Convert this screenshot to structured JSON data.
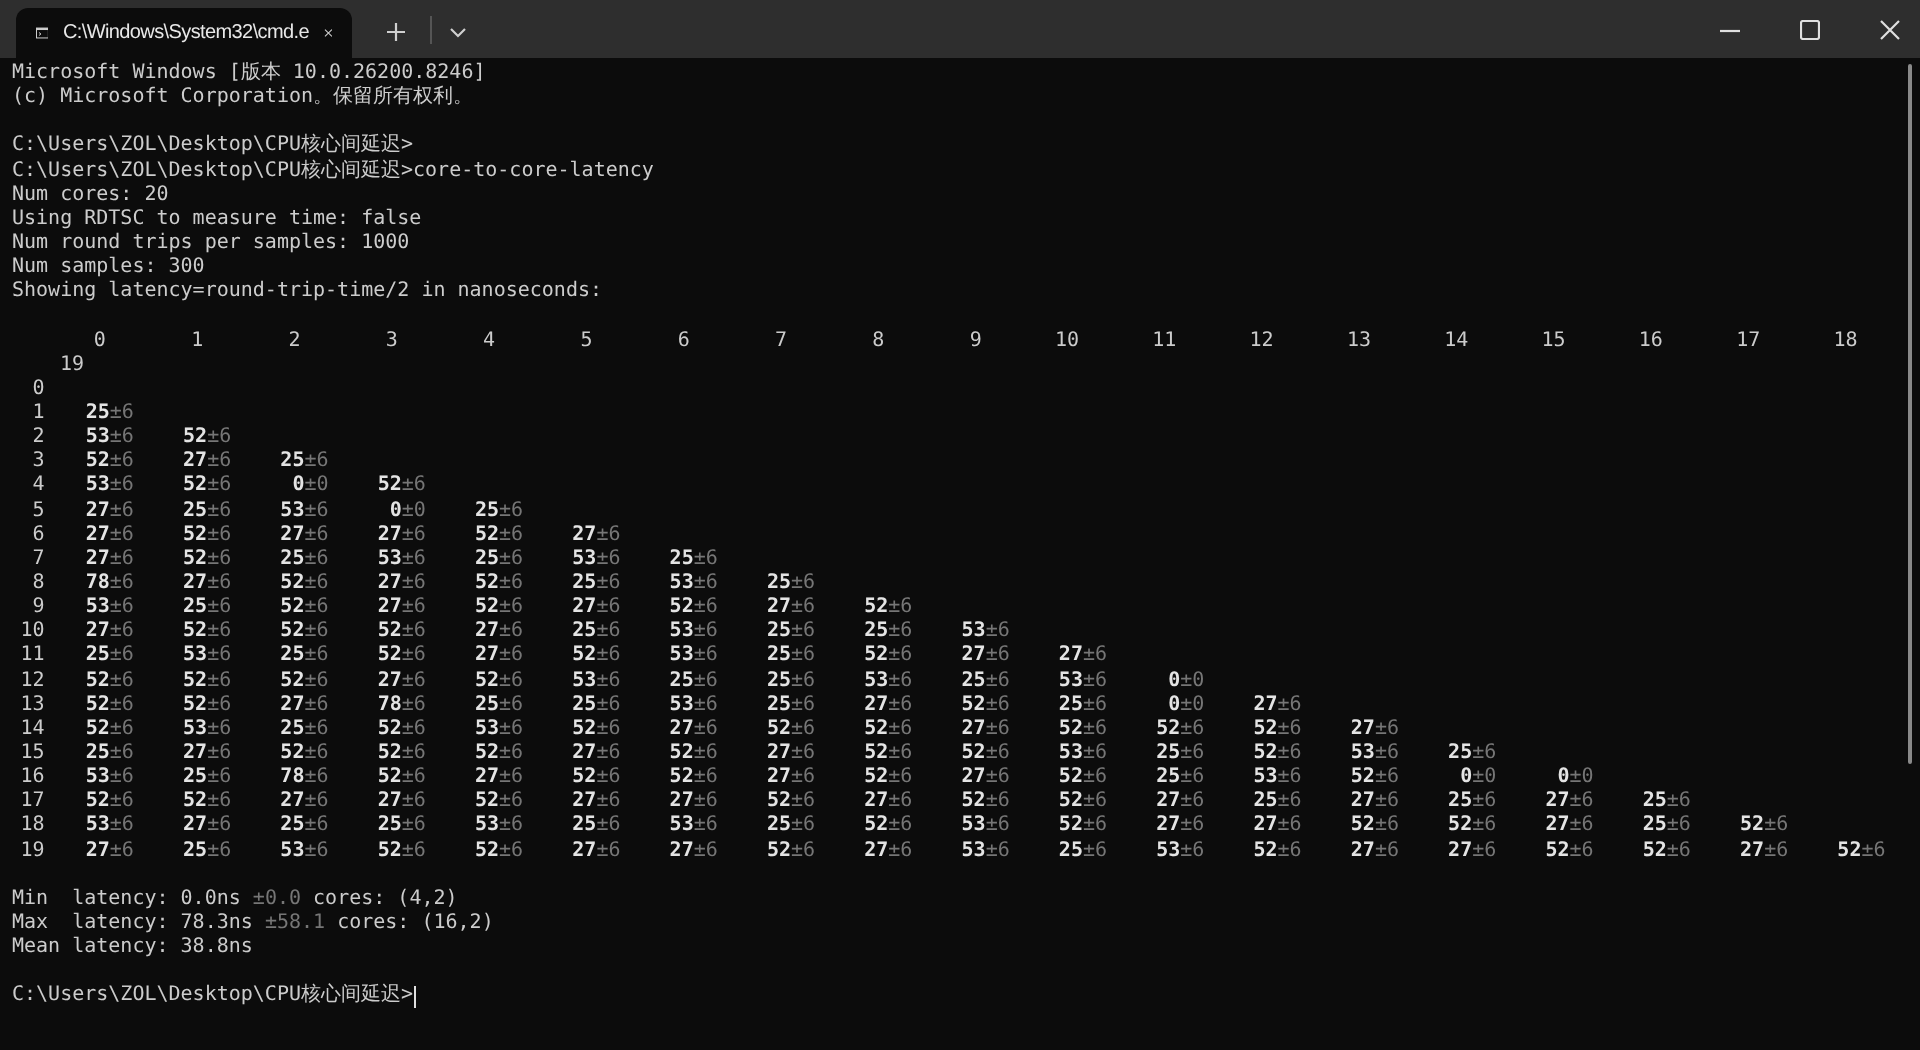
{
  "window": {
    "tab_title": "C:\\Windows\\System32\\cmd.e"
  },
  "output_blocks": [
    [
      "Microsoft Windows [版本 10.0.26200.8246]",
      "(c) Microsoft Corporation。保留所有权利。"
    ],
    [
      "C:\\Users\\ZOL\\Desktop\\CPU核心间延迟>",
      "C:\\Users\\ZOL\\Desktop\\CPU核心间延迟>core-to-core-latency",
      "Num cores: 20",
      "Using RDTSC to measure time: false",
      "Num round trips per samples: 1000",
      "Num samples: 300",
      "Showing latency=round-trip-time/2 in nanoseconds:"
    ]
  ],
  "table": {
    "columns": [
      "0",
      "1",
      "2",
      "3",
      "4",
      "5",
      "6",
      "7",
      "8",
      "9",
      "10",
      "11",
      "12",
      "13",
      "14",
      "15",
      "16",
      "17",
      "18",
      "19"
    ],
    "rows": [
      {
        "label": "0",
        "cells": []
      },
      {
        "label": "1",
        "cells": [
          {
            "value": "25",
            "error": "±6"
          }
        ]
      },
      {
        "label": "2",
        "cells": [
          {
            "value": "53",
            "error": "±6"
          },
          {
            "value": "52",
            "error": "±6"
          }
        ]
      },
      {
        "label": "3",
        "cells": [
          {
            "value": "52",
            "error": "±6"
          },
          {
            "value": "27",
            "error": "±6"
          },
          {
            "value": "25",
            "error": "±6"
          }
        ]
      },
      {
        "label": "4",
        "cells": [
          {
            "value": "53",
            "error": "±6"
          },
          {
            "value": "52",
            "error": "±6"
          },
          {
            "value": "0",
            "error": "±0"
          },
          {
            "value": "52",
            "error": "±6"
          }
        ]
      },
      {
        "label": "5",
        "cells": [
          {
            "value": "27",
            "error": "±6"
          },
          {
            "value": "25",
            "error": "±6"
          },
          {
            "value": "53",
            "error": "±6"
          },
          {
            "value": "0",
            "error": "±0"
          },
          {
            "value": "25",
            "error": "±6"
          }
        ]
      },
      {
        "label": "6",
        "cells": [
          {
            "value": "27",
            "error": "±6"
          },
          {
            "value": "52",
            "error": "±6"
          },
          {
            "value": "27",
            "error": "±6"
          },
          {
            "value": "27",
            "error": "±6"
          },
          {
            "value": "52",
            "error": "±6"
          },
          {
            "value": "27",
            "error": "±6"
          }
        ]
      },
      {
        "label": "7",
        "cells": [
          {
            "value": "27",
            "error": "±6"
          },
          {
            "value": "52",
            "error": "±6"
          },
          {
            "value": "25",
            "error": "±6"
          },
          {
            "value": "53",
            "error": "±6"
          },
          {
            "value": "25",
            "error": "±6"
          },
          {
            "value": "53",
            "error": "±6"
          },
          {
            "value": "25",
            "error": "±6"
          }
        ]
      },
      {
        "label": "8",
        "cells": [
          {
            "value": "78",
            "error": "±6"
          },
          {
            "value": "27",
            "error": "±6"
          },
          {
            "value": "52",
            "error": "±6"
          },
          {
            "value": "27",
            "error": "±6"
          },
          {
            "value": "52",
            "error": "±6"
          },
          {
            "value": "25",
            "error": "±6"
          },
          {
            "value": "53",
            "error": "±6"
          },
          {
            "value": "25",
            "error": "±6"
          }
        ]
      },
      {
        "label": "9",
        "cells": [
          {
            "value": "53",
            "error": "±6"
          },
          {
            "value": "25",
            "error": "±6"
          },
          {
            "value": "52",
            "error": "±6"
          },
          {
            "value": "27",
            "error": "±6"
          },
          {
            "value": "52",
            "error": "±6"
          },
          {
            "value": "27",
            "error": "±6"
          },
          {
            "value": "52",
            "error": "±6"
          },
          {
            "value": "27",
            "error": "±6"
          },
          {
            "value": "52",
            "error": "±6"
          }
        ]
      },
      {
        "label": "10",
        "cells": [
          {
            "value": "27",
            "error": "±6"
          },
          {
            "value": "52",
            "error": "±6"
          },
          {
            "value": "52",
            "error": "±6"
          },
          {
            "value": "52",
            "error": "±6"
          },
          {
            "value": "27",
            "error": "±6"
          },
          {
            "value": "25",
            "error": "±6"
          },
          {
            "value": "53",
            "error": "±6"
          },
          {
            "value": "25",
            "error": "±6"
          },
          {
            "value": "25",
            "error": "±6"
          },
          {
            "value": "53",
            "error": "±6"
          }
        ]
      },
      {
        "label": "11",
        "cells": [
          {
            "value": "25",
            "error": "±6"
          },
          {
            "value": "53",
            "error": "±6"
          },
          {
            "value": "25",
            "error": "±6"
          },
          {
            "value": "52",
            "error": "±6"
          },
          {
            "value": "27",
            "error": "±6"
          },
          {
            "value": "52",
            "error": "±6"
          },
          {
            "value": "53",
            "error": "±6"
          },
          {
            "value": "25",
            "error": "±6"
          },
          {
            "value": "52",
            "error": "±6"
          },
          {
            "value": "27",
            "error": "±6"
          },
          {
            "value": "27",
            "error": "±6"
          }
        ]
      },
      {
        "label": "12",
        "cells": [
          {
            "value": "52",
            "error": "±6"
          },
          {
            "value": "52",
            "error": "±6"
          },
          {
            "value": "52",
            "error": "±6"
          },
          {
            "value": "27",
            "error": "±6"
          },
          {
            "value": "52",
            "error": "±6"
          },
          {
            "value": "53",
            "error": "±6"
          },
          {
            "value": "25",
            "error": "±6"
          },
          {
            "value": "25",
            "error": "±6"
          },
          {
            "value": "53",
            "error": "±6"
          },
          {
            "value": "25",
            "error": "±6"
          },
          {
            "value": "53",
            "error": "±6"
          },
          {
            "value": "0",
            "error": "±0"
          }
        ]
      },
      {
        "label": "13",
        "cells": [
          {
            "value": "52",
            "error": "±6"
          },
          {
            "value": "52",
            "error": "±6"
          },
          {
            "value": "27",
            "error": "±6"
          },
          {
            "value": "78",
            "error": "±6"
          },
          {
            "value": "25",
            "error": "±6"
          },
          {
            "value": "25",
            "error": "±6"
          },
          {
            "value": "53",
            "error": "±6"
          },
          {
            "value": "25",
            "error": "±6"
          },
          {
            "value": "27",
            "error": "±6"
          },
          {
            "value": "52",
            "error": "±6"
          },
          {
            "value": "25",
            "error": "±6"
          },
          {
            "value": "0",
            "error": "±0"
          },
          {
            "value": "27",
            "error": "±6"
          }
        ]
      },
      {
        "label": "14",
        "cells": [
          {
            "value": "52",
            "error": "±6"
          },
          {
            "value": "53",
            "error": "±6"
          },
          {
            "value": "25",
            "error": "±6"
          },
          {
            "value": "52",
            "error": "±6"
          },
          {
            "value": "53",
            "error": "±6"
          },
          {
            "value": "52",
            "error": "±6"
          },
          {
            "value": "27",
            "error": "±6"
          },
          {
            "value": "52",
            "error": "±6"
          },
          {
            "value": "52",
            "error": "±6"
          },
          {
            "value": "27",
            "error": "±6"
          },
          {
            "value": "52",
            "error": "±6"
          },
          {
            "value": "52",
            "error": "±6"
          },
          {
            "value": "52",
            "error": "±6"
          },
          {
            "value": "27",
            "error": "±6"
          }
        ]
      },
      {
        "label": "15",
        "cells": [
          {
            "value": "25",
            "error": "±6"
          },
          {
            "value": "27",
            "error": "±6"
          },
          {
            "value": "52",
            "error": "±6"
          },
          {
            "value": "52",
            "error": "±6"
          },
          {
            "value": "52",
            "error": "±6"
          },
          {
            "value": "27",
            "error": "±6"
          },
          {
            "value": "52",
            "error": "±6"
          },
          {
            "value": "27",
            "error": "±6"
          },
          {
            "value": "52",
            "error": "±6"
          },
          {
            "value": "52",
            "error": "±6"
          },
          {
            "value": "53",
            "error": "±6"
          },
          {
            "value": "25",
            "error": "±6"
          },
          {
            "value": "52",
            "error": "±6"
          },
          {
            "value": "53",
            "error": "±6"
          },
          {
            "value": "25",
            "error": "±6"
          }
        ]
      },
      {
        "label": "16",
        "cells": [
          {
            "value": "53",
            "error": "±6"
          },
          {
            "value": "25",
            "error": "±6"
          },
          {
            "value": "78",
            "error": "±6"
          },
          {
            "value": "52",
            "error": "±6"
          },
          {
            "value": "27",
            "error": "±6"
          },
          {
            "value": "52",
            "error": "±6"
          },
          {
            "value": "52",
            "error": "±6"
          },
          {
            "value": "27",
            "error": "±6"
          },
          {
            "value": "52",
            "error": "±6"
          },
          {
            "value": "27",
            "error": "±6"
          },
          {
            "value": "52",
            "error": "±6"
          },
          {
            "value": "25",
            "error": "±6"
          },
          {
            "value": "53",
            "error": "±6"
          },
          {
            "value": "52",
            "error": "±6"
          },
          {
            "value": "0",
            "error": "±0"
          },
          {
            "value": "0",
            "error": "±0"
          }
        ]
      },
      {
        "label": "17",
        "cells": [
          {
            "value": "52",
            "error": "±6"
          },
          {
            "value": "52",
            "error": "±6"
          },
          {
            "value": "27",
            "error": "±6"
          },
          {
            "value": "27",
            "error": "±6"
          },
          {
            "value": "52",
            "error": "±6"
          },
          {
            "value": "27",
            "error": "±6"
          },
          {
            "value": "27",
            "error": "±6"
          },
          {
            "value": "52",
            "error": "±6"
          },
          {
            "value": "27",
            "error": "±6"
          },
          {
            "value": "52",
            "error": "±6"
          },
          {
            "value": "52",
            "error": "±6"
          },
          {
            "value": "27",
            "error": "±6"
          },
          {
            "value": "25",
            "error": "±6"
          },
          {
            "value": "27",
            "error": "±6"
          },
          {
            "value": "25",
            "error": "±6"
          },
          {
            "value": "27",
            "error": "±6"
          },
          {
            "value": "25",
            "error": "±6"
          }
        ]
      },
      {
        "label": "18",
        "cells": [
          {
            "value": "53",
            "error": "±6"
          },
          {
            "value": "27",
            "error": "±6"
          },
          {
            "value": "25",
            "error": "±6"
          },
          {
            "value": "25",
            "error": "±6"
          },
          {
            "value": "53",
            "error": "±6"
          },
          {
            "value": "25",
            "error": "±6"
          },
          {
            "value": "53",
            "error": "±6"
          },
          {
            "value": "25",
            "error": "±6"
          },
          {
            "value": "52",
            "error": "±6"
          },
          {
            "value": "53",
            "error": "±6"
          },
          {
            "value": "52",
            "error": "±6"
          },
          {
            "value": "27",
            "error": "±6"
          },
          {
            "value": "27",
            "error": "±6"
          },
          {
            "value": "52",
            "error": "±6"
          },
          {
            "value": "52",
            "error": "±6"
          },
          {
            "value": "27",
            "error": "±6"
          },
          {
            "value": "25",
            "error": "±6"
          },
          {
            "value": "52",
            "error": "±6"
          }
        ]
      },
      {
        "label": "19",
        "cells": [
          {
            "value": "27",
            "error": "±6"
          },
          {
            "value": "25",
            "error": "±6"
          },
          {
            "value": "53",
            "error": "±6"
          },
          {
            "value": "52",
            "error": "±6"
          },
          {
            "value": "52",
            "error": "±6"
          },
          {
            "value": "27",
            "error": "±6"
          },
          {
            "value": "27",
            "error": "±6"
          },
          {
            "value": "52",
            "error": "±6"
          },
          {
            "value": "27",
            "error": "±6"
          },
          {
            "value": "53",
            "error": "±6"
          },
          {
            "value": "25",
            "error": "±6"
          },
          {
            "value": "53",
            "error": "±6"
          },
          {
            "value": "52",
            "error": "±6"
          },
          {
            "value": "27",
            "error": "±6"
          },
          {
            "value": "27",
            "error": "±6"
          },
          {
            "value": "52",
            "error": "±6"
          },
          {
            "value": "52",
            "error": "±6"
          },
          {
            "value": "27",
            "error": "±6"
          },
          {
            "value": "52",
            "error": "±6"
          }
        ]
      }
    ]
  },
  "stats": [
    {
      "label": "Min  latency:",
      "value": "0.0ns",
      "error": "±0.0",
      "cores": "cores: (4,2)"
    },
    {
      "label": "Max  latency:",
      "value": "78.3ns",
      "error": "±58.1",
      "cores": "cores: (16,2)"
    },
    {
      "label": "Mean latency:",
      "value": "38.8ns"
    }
  ],
  "prompt": "C:\\Users\\ZOL\\Desktop\\CPU核心间延迟>"
}
